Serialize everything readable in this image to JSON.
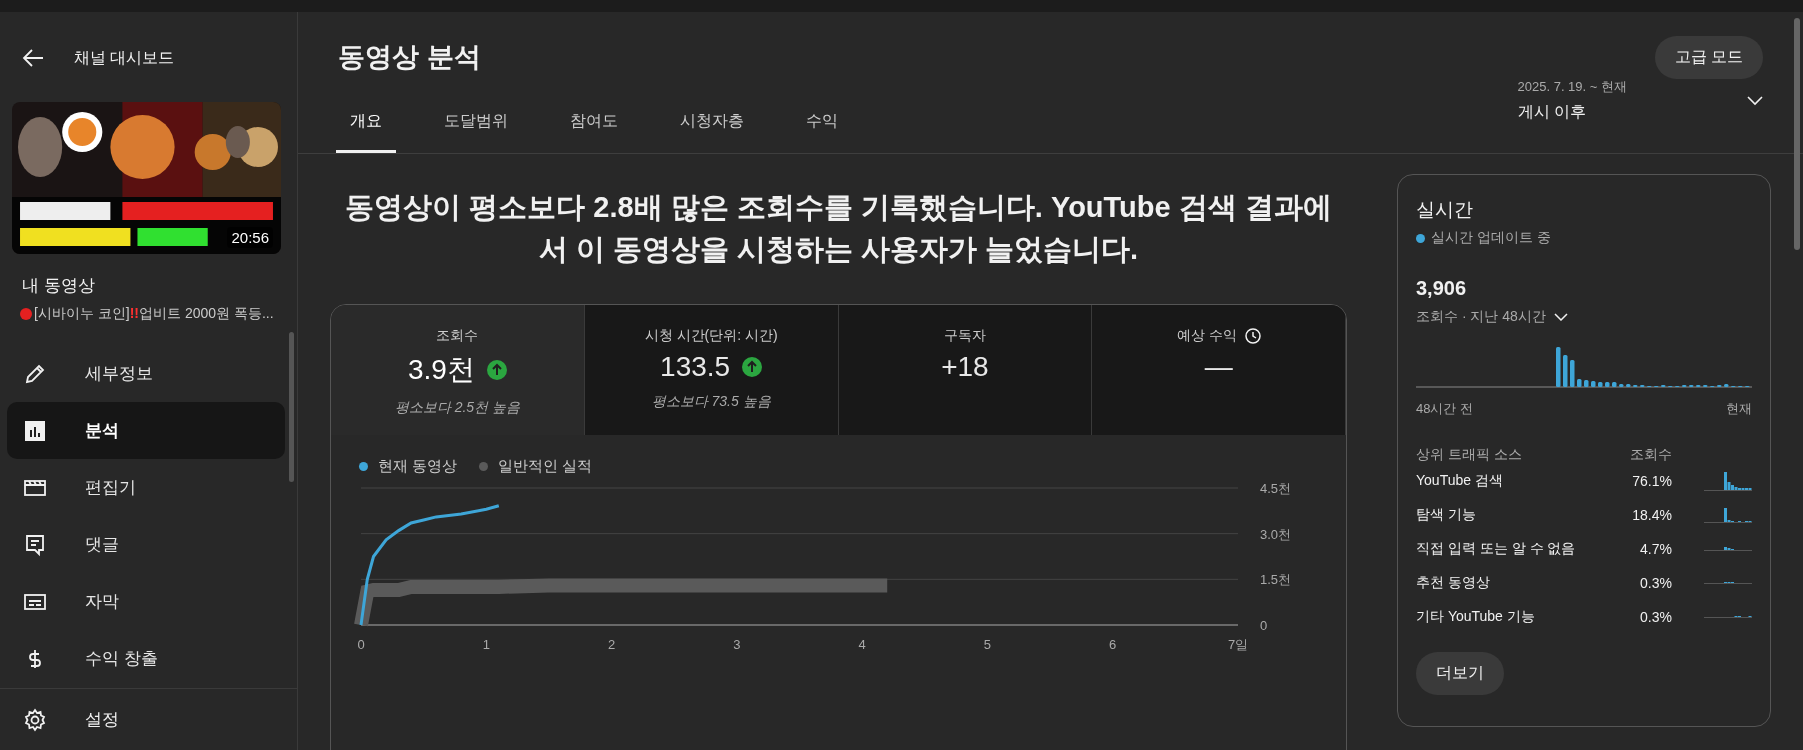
{
  "sidebar": {
    "back_title": "채널 대시보드",
    "video": {
      "thumbnail": {
        "kind": "picture",
        "duration": "20:56"
      },
      "label": "내 동영상",
      "title_parts": [
        {
          "text": "[시바이누 코인]",
          "accent": false
        },
        {
          "text": "!!",
          "accent": true
        },
        {
          "text": "업비트 2000원 폭등...",
          "accent": false
        }
      ]
    },
    "items": [
      {
        "label": "세부정보",
        "selected": false
      },
      {
        "label": "분석",
        "selected": true
      },
      {
        "label": "편집기",
        "selected": false
      },
      {
        "label": "댓글",
        "selected": false
      },
      {
        "label": "자막",
        "selected": false
      },
      {
        "label": "수익 창출",
        "selected": false
      }
    ],
    "footer_item": {
      "label": "설정"
    }
  },
  "header": {
    "title": "동영상 분석",
    "advanced_button": "고급 모드"
  },
  "tabs": [
    {
      "label": "개요",
      "selected": true
    },
    {
      "label": "도달범위",
      "selected": false
    },
    {
      "label": "참여도",
      "selected": false
    },
    {
      "label": "시청자층",
      "selected": false
    },
    {
      "label": "수익",
      "selected": false
    }
  ],
  "date_range": {
    "range": "2025. 7. 19. ~ 현재",
    "label": "게시 이후"
  },
  "headline": "동영상이 평소보다 **2.8배** 많은 조회수를 기록했습니다. **YouTube** 검색 결과에서 이 동영상을 시청하는 사용자가 늘었습니다.",
  "metrics": [
    {
      "label": "조회수",
      "value": "3.9천",
      "kind": "trend",
      "comparison": "평소보다 2.5천 높음",
      "selected": true
    },
    {
      "label": "시청 시간(단위: 시간)",
      "value": "133.5",
      "kind": "trend",
      "comparison": "평소보다 73.5 높음",
      "selected": false
    },
    {
      "label": "구독자",
      "value": "+18",
      "kind": "plain",
      "selected": false
    },
    {
      "label": "예상 수익",
      "value": "—",
      "kind": "timed",
      "selected": false
    }
  ],
  "chart_data": {
    "type": "line",
    "x": [
      0,
      0.05,
      0.1,
      0.2,
      0.3,
      0.4,
      0.5,
      0.6,
      0.8,
      1.0,
      1.1,
      1.5,
      2,
      3,
      4,
      4.2
    ],
    "series": [
      {
        "name": "현재 동영상",
        "color": "#3ea6d8",
        "values": [
          0,
          1.5,
          2.25,
          2.8,
          3.1,
          3.35,
          3.45,
          3.55,
          3.65,
          3.8,
          3.92,
          null,
          null,
          null,
          null,
          null
        ]
      },
      {
        "name": "일반적인 실적",
        "color": "#5a5a5a",
        "values": [
          0,
          1.1,
          1.15,
          1.15,
          1.15,
          1.25,
          1.25,
          1.25,
          1.25,
          1.25,
          1.25,
          1.3,
          1.3,
          1.3,
          1.3,
          1.3
        ]
      }
    ],
    "xlim": [
      0,
      7
    ],
    "ylim": [
      0,
      4.5
    ],
    "xticks": [
      0,
      1,
      2,
      3,
      4,
      5,
      6,
      {
        "value": 7,
        "label": "7일"
      }
    ],
    "yticks": [
      0,
      {
        "value": 1.5,
        "label": "1.5천"
      },
      {
        "value": 3,
        "label": "3.0천"
      },
      {
        "value": 4.5,
        "label": "4.5천"
      }
    ]
  },
  "realtime": {
    "title": "실시간",
    "status": "실시간 업데이트 중",
    "count": "3,906",
    "period": "조회수 · 지난 48시간",
    "start_label": "48시간 전",
    "end_label": "현재",
    "sources_header": "상위 트래픽 소스",
    "views_header": "조회수",
    "sources": [
      {
        "name": "YouTube 검색",
        "share": "76.1%"
      },
      {
        "name": "탐색 기능",
        "share": "18.4%"
      },
      {
        "name": "직접 입력 또는 알 수 없음",
        "share": "4.7%"
      },
      {
        "name": "추천 동영상",
        "share": "0.3%"
      },
      {
        "name": "기타 YouTube 기능",
        "share": "0.3%"
      }
    ],
    "more_button": "더보기"
  }
}
